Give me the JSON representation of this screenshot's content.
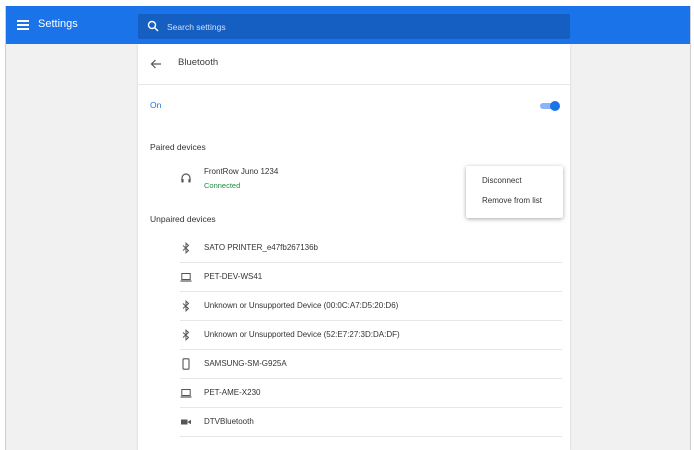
{
  "header": {
    "app_title": "Settings"
  },
  "search": {
    "placeholder": "Search settings"
  },
  "page": {
    "title": "Bluetooth"
  },
  "bluetooth": {
    "state_label": "On",
    "enabled": true
  },
  "sections": {
    "paired_title": "Paired devices",
    "unpaired_title": "Unpaired devices"
  },
  "paired_devices": [
    {
      "name": "FrontRow Juno 1234",
      "status": "Connected",
      "icon": "headphones-icon"
    }
  ],
  "context_menu": {
    "items": [
      "Disconnect",
      "Remove from list"
    ]
  },
  "unpaired_devices": [
    {
      "name": "SATO PRINTER_e47fb267136b",
      "icon": "bluetooth-icon"
    },
    {
      "name": "PET-DEV-WS41",
      "icon": "laptop-icon"
    },
    {
      "name": "Unknown or Unsupported Device (00:0C:A7:D5:20:D6)",
      "icon": "bluetooth-icon"
    },
    {
      "name": "Unknown or Unsupported Device (52:E7:27:3D:DA:DF)",
      "icon": "bluetooth-icon"
    },
    {
      "name": "SAMSUNG-SM-G925A",
      "icon": "phone-icon"
    },
    {
      "name": "PET-AME-X230",
      "icon": "laptop-icon"
    },
    {
      "name": "DTVBluetooth",
      "icon": "video-icon"
    }
  ],
  "colors": {
    "accent": "#1a73e8",
    "connected": "#1e8e3e"
  }
}
